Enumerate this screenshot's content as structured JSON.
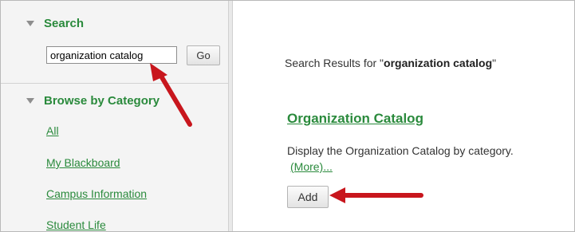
{
  "sidebar": {
    "search": {
      "heading": "Search",
      "input_value": "organization catalog",
      "go_label": "Go"
    },
    "browse": {
      "heading": "Browse by Category",
      "items": [
        "All",
        "My Blackboard",
        "Campus Information",
        "Student Life"
      ]
    }
  },
  "results": {
    "heading_prefix": "Search Results for \"",
    "query": "organization catalog",
    "heading_suffix": "\"",
    "module": {
      "title": "Organization Catalog",
      "description": "Display the Organization Catalog by category.",
      "more_label": "(More)...",
      "add_label": "Add"
    }
  },
  "colors": {
    "accent_green": "#2a8a3c",
    "annotation_red": "#c8161d"
  },
  "icons": [
    "collapse-triangle-icon",
    "annotation-arrow"
  ]
}
